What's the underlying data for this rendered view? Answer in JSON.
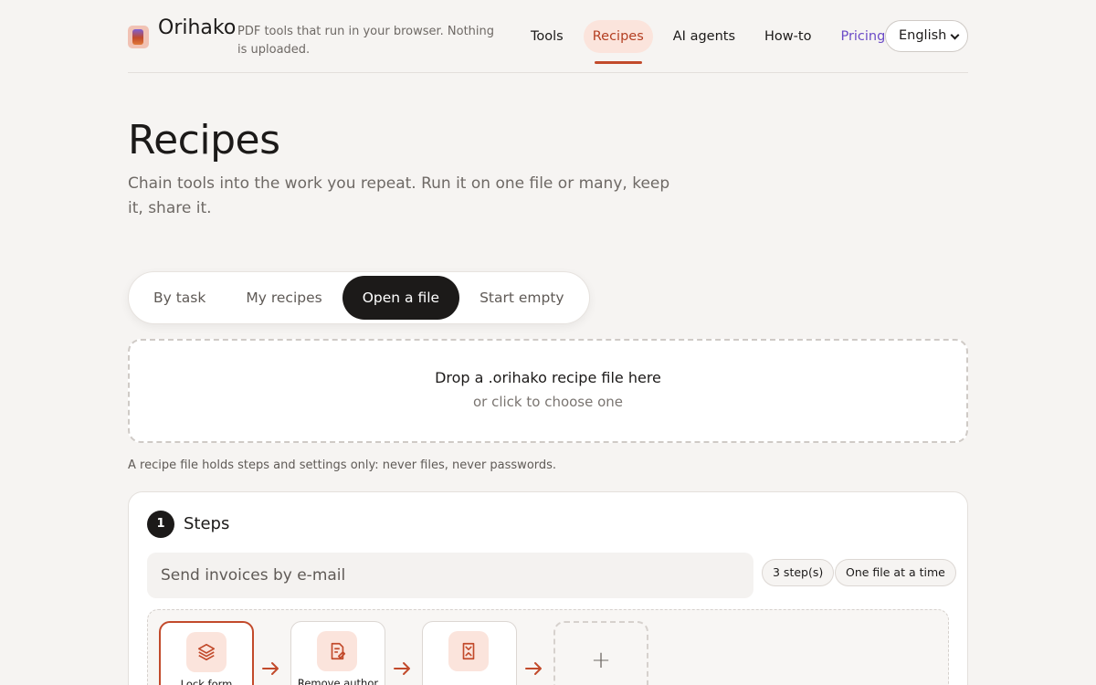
{
  "header": {
    "brand": "Orihako",
    "tagline": "PDF tools that run in your browser. Nothing is uploaded.",
    "nav": [
      {
        "label": "Tools"
      },
      {
        "label": "Recipes",
        "active": true
      },
      {
        "label": "AI agents"
      },
      {
        "label": "How-to"
      },
      {
        "label": "Pricing"
      }
    ],
    "language": "English"
  },
  "hero": {
    "title": "Recipes",
    "subtitle": "Chain tools into the work you repeat. Run it on one file or many, keep it, share it."
  },
  "tabs": [
    {
      "label": "By task"
    },
    {
      "label": "My recipes"
    },
    {
      "label": "Open a file",
      "active": true
    },
    {
      "label": "Start empty"
    }
  ],
  "dropzone": {
    "title": "Drop a .orihako recipe file here",
    "subtitle": "or click to choose one"
  },
  "note": "A recipe file holds steps and settings only: never files, never passwords.",
  "steps_card": {
    "number": "1",
    "title": "Steps",
    "recipe_name": "Send invoices by e-mail",
    "step_count": "3 step(s)",
    "mode": "One file at a time",
    "steps": [
      {
        "label": "Lock form",
        "icon": "layers-icon",
        "selected": true
      },
      {
        "label": "Remove author",
        "icon": "document-edit-icon"
      },
      {
        "label": "",
        "icon": "compress-icon"
      }
    ],
    "add_symbol": "+"
  },
  "colors": {
    "accent": "#c24a2b",
    "accent_soft": "#fbe4dc",
    "pricing": "#6b4bc7",
    "ink": "#1c1a19",
    "background": "#f6f4f2"
  }
}
